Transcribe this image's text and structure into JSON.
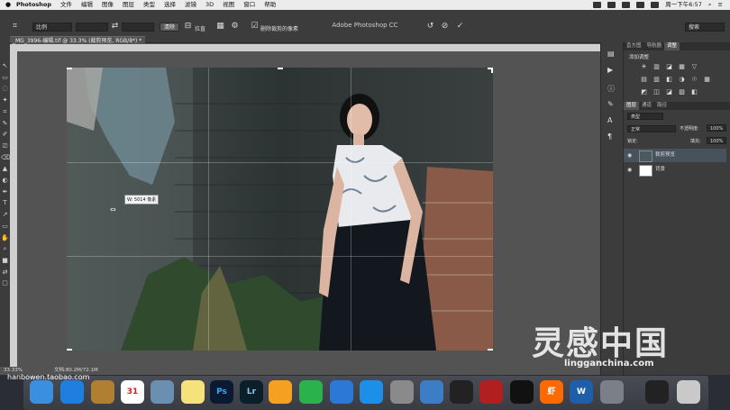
{
  "menubar": {
    "apple": "",
    "items": [
      "Photoshop",
      "文件",
      "编辑",
      "图像",
      "图层",
      "类型",
      "选择",
      "滤镜",
      "3D",
      "视图",
      "窗口",
      "帮助"
    ],
    "clock": "周一下午6:57"
  },
  "window_title": "Adobe Photoshop CC",
  "options": {
    "ratio_label": "比例",
    "clear_button": "清除",
    "straighten": "拉直",
    "delete_cropped_label": "删除裁剪的像素",
    "search_placeholder": "搜索"
  },
  "doc_tab": "_MG_3996-编辑.tif @ 33.3% (裁剪预览, RGB/8*) *",
  "tools": [
    "↖",
    "▭",
    "◌",
    "✦",
    "⌗",
    "✎",
    "✐",
    "⎚",
    "⌫",
    "▲",
    "◐",
    "✒",
    "T",
    "↗",
    "▭",
    "✋",
    "⌕",
    "■",
    "⇄",
    "▢"
  ],
  "crop_tooltip": "W: 5014 像素",
  "status": {
    "zoom": "33.33%",
    "doc_size": "文档:80.2M/72.1M"
  },
  "panels": {
    "top_tabs": [
      "直方图",
      "导航器",
      "调整"
    ],
    "top_tab_active": 2,
    "adjust_header": "添加调整",
    "adjust_icons_row1": [
      "☀",
      "▥",
      "◪",
      "▦",
      "▽",
      ""
    ],
    "adjust_icons_row2": [
      "▤",
      "▥",
      "◧",
      "◑",
      "☉",
      "▦"
    ],
    "adjust_icons_row3": [
      "◩",
      "◫",
      "◪",
      "▨",
      "◧",
      ""
    ],
    "layer_tabs": [
      "图层",
      "通道",
      "路径"
    ],
    "layer_tab_active": 0,
    "kind_label": "类型",
    "blend_mode": "正常",
    "opacity_label": "不透明度:",
    "opacity_value": "100%",
    "lock_label": "锁定:",
    "fill_label": "填充:",
    "fill_value": "100%",
    "layers": [
      {
        "name": "裁剪预览",
        "selected": true
      },
      {
        "name": "背景",
        "selected": false
      }
    ]
  },
  "dock": {
    "icons": [
      "finder",
      "safari",
      "preview",
      "calendar",
      "photos",
      "notes",
      "photoshop",
      "lightroom",
      "pages",
      "numbers",
      "keynote",
      "appstore",
      "settings",
      "xcode",
      "finalcut",
      "photobooth",
      "qq",
      "xiami",
      "word",
      "launchpad",
      "screens",
      "trash"
    ],
    "calendar_day": "31",
    "ps_label": "Ps",
    "lr_label": "Lr",
    "w_label": "W",
    "xia_label": "虾"
  },
  "watermarks": {
    "left": "hanbowen.taobao.com",
    "right_logo": "灵感中国",
    "right_url": "lingganchina.com"
  },
  "colors": {
    "menubar": "#ececec",
    "panel_bg": "#3c3c3c",
    "canvas_bg": "#535353",
    "selected_layer": "#46525c"
  }
}
